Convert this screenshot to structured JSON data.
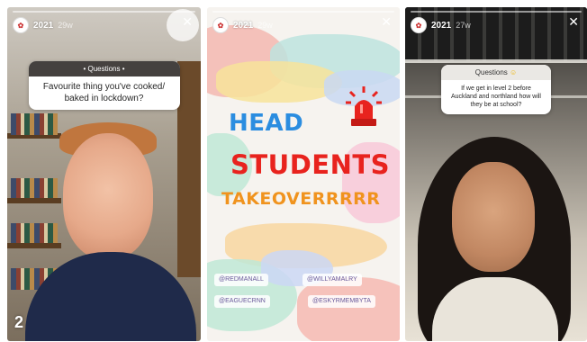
{
  "panels": [
    {
      "user": "2021",
      "time": "29w",
      "question_header": "• Questions •",
      "question": "Favourite thing you've cooked/ baked in lockdown?",
      "number": "2"
    },
    {
      "user": "2021",
      "time": "29w",
      "words": [
        "HEAD",
        "STUDENTS",
        "TAKEOVERRRRR"
      ],
      "tags": [
        "@REDMANALL",
        "@WILLYAMALRY",
        "@EAGUECRNN",
        "@ESKYRMEMBYTA"
      ]
    },
    {
      "user": "2021",
      "time": "27w",
      "question_header": "Questions",
      "question": "If we get in level 2 before Auckland and northland how will they be at school?"
    }
  ],
  "colors": {
    "head": "#2b8de0",
    "students": "#e8231e",
    "takeover": "#f0931e",
    "card_header": "#45413f"
  },
  "icons": [
    "close-icon",
    "siren-icon",
    "avatar-icon"
  ]
}
